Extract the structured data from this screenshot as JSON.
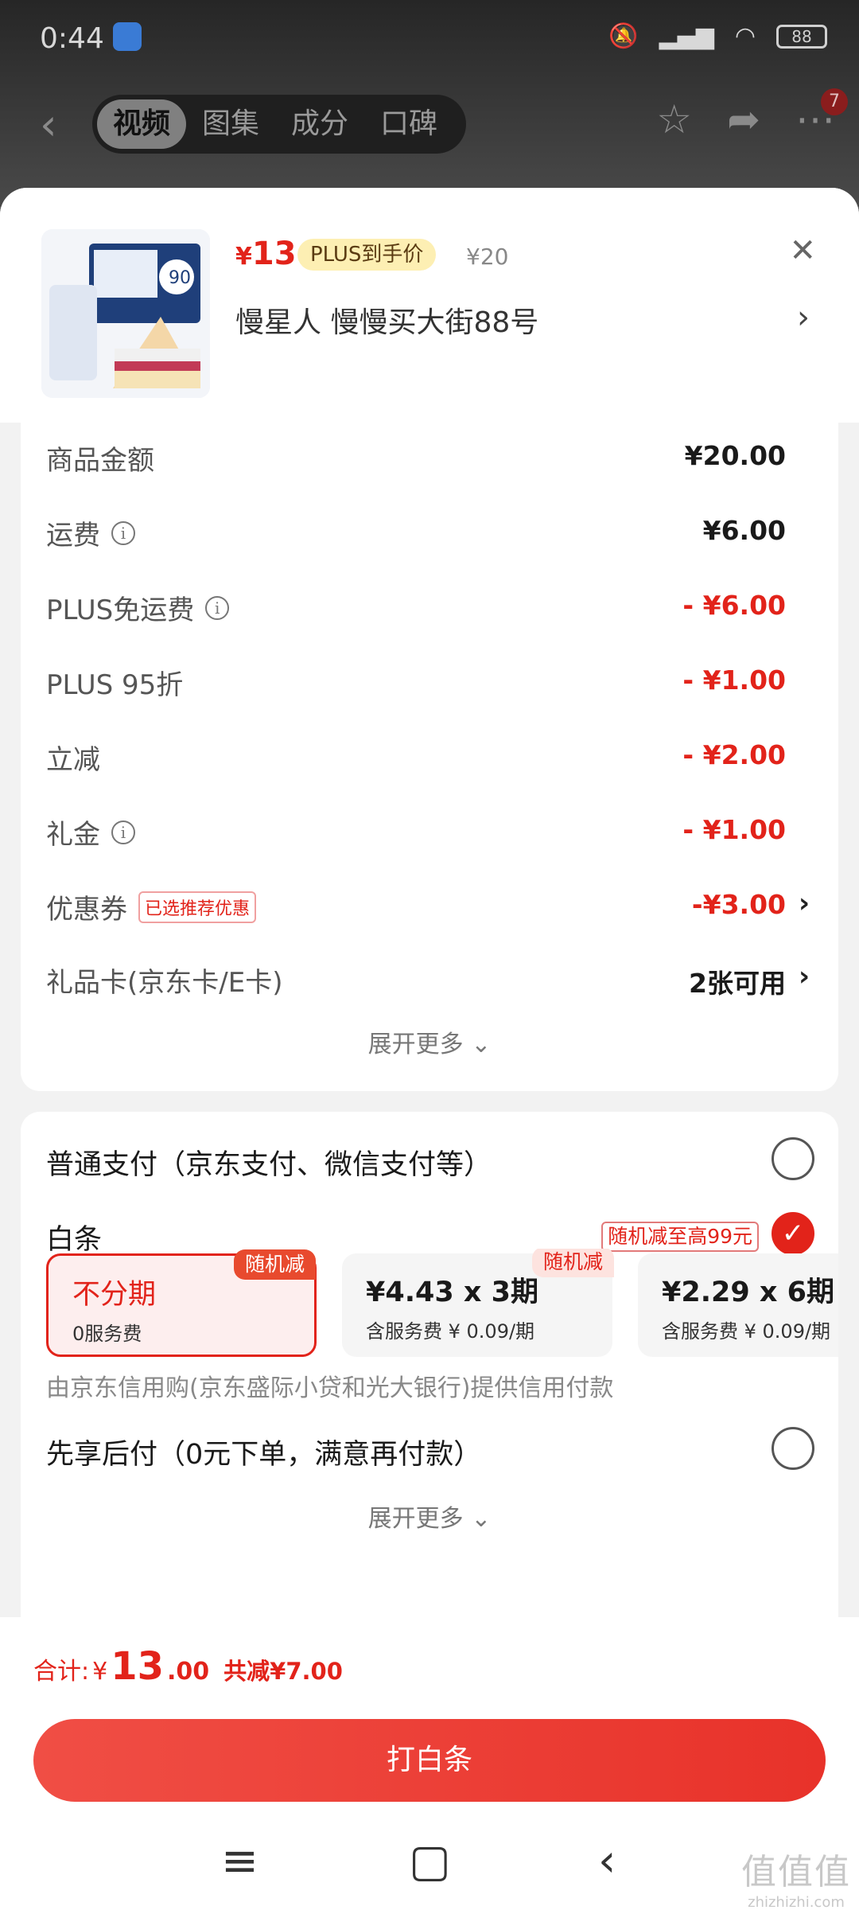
{
  "status_bar": {
    "time": "0:44",
    "battery": "88"
  },
  "nav": {
    "back_icon": "back-arrow-icon",
    "tabs": [
      {
        "label": "视频",
        "active": true
      },
      {
        "label": "图集",
        "active": false
      },
      {
        "label": "成分",
        "active": false
      },
      {
        "label": "口碑",
        "active": false
      }
    ],
    "message_count": "7"
  },
  "product": {
    "price_current": "13",
    "currency": "¥",
    "plus_tag": "PLUS到手价",
    "price_original": "¥20",
    "address": "慢星人  慢慢买大街88号"
  },
  "summary": {
    "rows": [
      {
        "label": "商品金额",
        "value": "¥20.00"
      },
      {
        "label": "运费",
        "value": "¥6.00"
      },
      {
        "label": "PLUS免运费",
        "value": "- ¥6.00"
      },
      {
        "label": "PLUS 95折",
        "value": "- ¥1.00"
      },
      {
        "label": "立减",
        "value": "- ¥2.00"
      },
      {
        "label": "礼金",
        "value": "- ¥1.00"
      },
      {
        "label": "优惠券",
        "tag": "已选推荐优惠",
        "value": "-¥3.00"
      },
      {
        "label": "礼品卡(京东卡/E卡)",
        "value": "2张可用"
      }
    ],
    "expand_more": "展开更多"
  },
  "payment": {
    "normal_pay": "普通支付（京东支付、微信支付等）",
    "baitiao": "白条",
    "baitiao_promo": "随机减至高99元",
    "plans": [
      {
        "title": "不分期",
        "sub": "0服务费",
        "badge": "随机减"
      },
      {
        "title": "¥4.43 x 3期",
        "sub": "含服务费 ¥ 0.09/期",
        "badge": "随机减"
      },
      {
        "title": "¥2.29 x 6期",
        "sub": "含服务费 ¥ 0.09/期"
      }
    ],
    "credit_note": "由京东信用购(京东盛际小贷和光大银行)提供信用付款",
    "pay_later": "先享后付（0元下单，满意再付款）",
    "expand_more": "展开更多"
  },
  "footer": {
    "total_label": "合计:",
    "total_currency": "¥",
    "total_int": "13",
    "total_dec": ".00",
    "total_save": "共减¥7.00",
    "button_label": "打白条"
  },
  "watermark": {
    "big": "值值值",
    "small": "zhizhizhi.com"
  }
}
